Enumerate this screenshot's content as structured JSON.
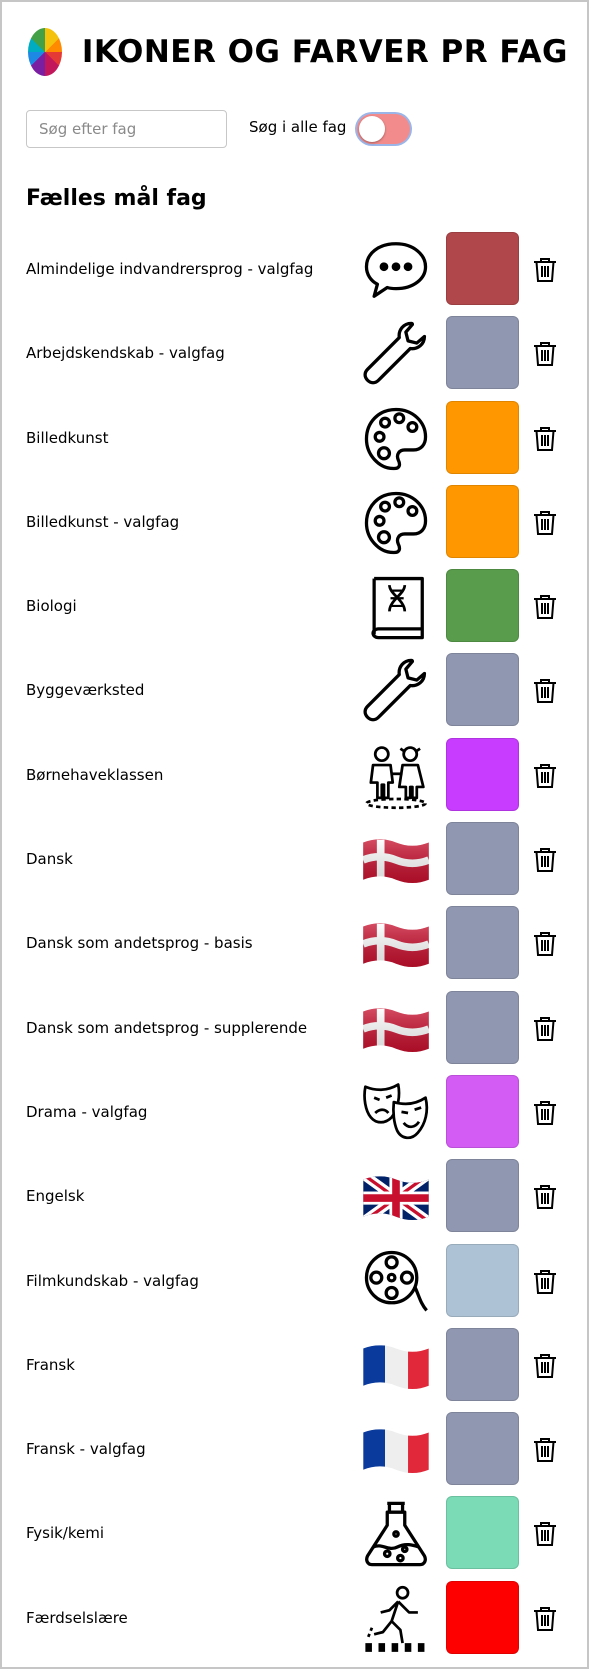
{
  "header": {
    "title": "IKONER OG FARVER PR FAG",
    "logo_icon": "color-wheel-icon"
  },
  "search": {
    "placeholder": "Søg efter fag",
    "value": ""
  },
  "toggle": {
    "label": "Søg i alle fag",
    "on": false
  },
  "section": {
    "title": "Fælles mål fag"
  },
  "subjects": [
    {
      "label": "Almindelige indvandrersprog - valgfag",
      "icon": "speech-bubble-icon",
      "color": "#b0474b"
    },
    {
      "label": "Arbejdskendskab - valgfag",
      "icon": "wrench-icon",
      "color": "#9097b0"
    },
    {
      "label": "Billedkunst",
      "icon": "palette-icon",
      "color": "#ff9800"
    },
    {
      "label": "Billedkunst - valgfag",
      "icon": "palette-icon",
      "color": "#ff9800"
    },
    {
      "label": "Biologi",
      "icon": "dna-book-icon",
      "color": "#599c4c"
    },
    {
      "label": "Byggeværksted",
      "icon": "wrench-icon",
      "color": "#9097b0"
    },
    {
      "label": "Børnehaveklassen",
      "icon": "children-icon",
      "color": "#c83cff"
    },
    {
      "label": "Dansk",
      "icon": "danish-flag-icon",
      "color": "#9097b0"
    },
    {
      "label": "Dansk som andetsprog - basis",
      "icon": "danish-flag-icon",
      "color": "#9097b0"
    },
    {
      "label": "Dansk som andetsprog - supplerende",
      "icon": "danish-flag-icon",
      "color": "#9097b0"
    },
    {
      "label": "Drama - valgfag",
      "icon": "theater-masks-icon",
      "color": "#d35cf5"
    },
    {
      "label": "Engelsk",
      "icon": "uk-flag-icon",
      "color": "#9097b0"
    },
    {
      "label": "Filmkundskab - valgfag",
      "icon": "film-reel-icon",
      "color": "#adc3d5"
    },
    {
      "label": "Fransk",
      "icon": "french-flag-icon",
      "color": "#9097b0"
    },
    {
      "label": "Fransk - valgfag",
      "icon": "french-flag-icon",
      "color": "#9097b0"
    },
    {
      "label": "Fysik/kemi",
      "icon": "flask-icon",
      "color": "#7adbb6"
    },
    {
      "label": "Færdselslære",
      "icon": "pedestrian-crossing-icon",
      "color": "#ff0000"
    }
  ]
}
